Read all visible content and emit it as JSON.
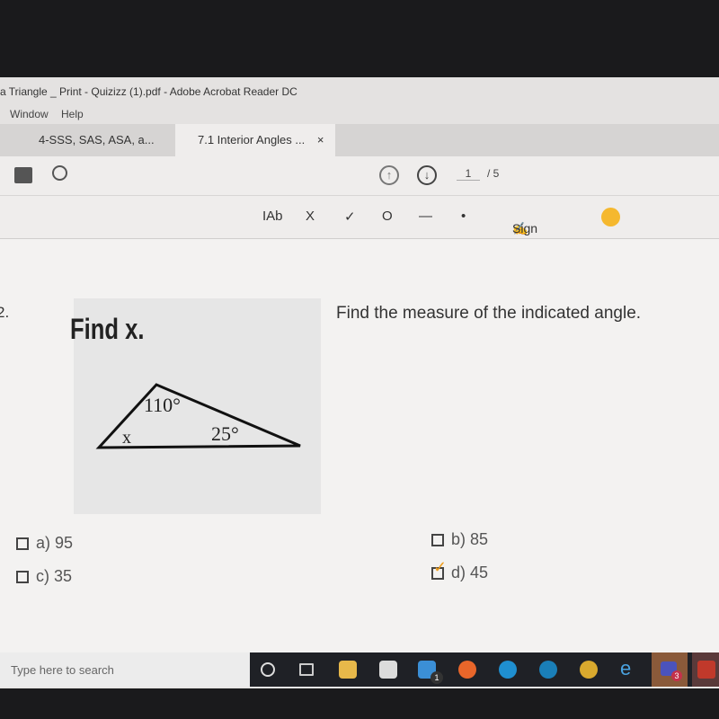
{
  "window": {
    "title": "a Triangle _ Print - Quizizz (1).pdf - Adobe Acrobat Reader DC"
  },
  "menu": [
    "Window",
    "Help"
  ],
  "tabs": [
    {
      "label": "4-SSS, SAS, ASA, a..."
    },
    {
      "label": "7.1 Interior Angles ...",
      "close": "×",
      "active": true
    }
  ],
  "toolbar": {
    "page_current": "1",
    "page_total": "/ 5"
  },
  "annotation_tools": {
    "text": "IAb",
    "cross": "X",
    "check": "✓",
    "circle": "O",
    "line": "—",
    "dot": "•",
    "sign": "Sign",
    "color": "#f5b82e"
  },
  "question": {
    "number": "2.",
    "figure_title": "Find x.",
    "angle_top": "110°",
    "angle_right": "25°",
    "angle_left": "x",
    "prompt": "Find the measure of the indicated angle."
  },
  "options": [
    {
      "label": "a) 95",
      "checked": false
    },
    {
      "label": "b) 85",
      "checked": false
    },
    {
      "label": "c) 35",
      "checked": false
    },
    {
      "label": "d) 45",
      "checked": true
    }
  ],
  "taskbar": {
    "search_placeholder": "Type here to search",
    "mail_badge": "1",
    "teams_badge": "3",
    "icons": [
      "cortana-icon",
      "task-view-icon",
      "file-explorer-icon",
      "store-icon",
      "mail-icon",
      "firefox-icon",
      "edge-icon",
      "edge-beta-icon",
      "chrome-icon",
      "internet-explorer-icon",
      "teams-icon",
      "acrobat-icon"
    ]
  }
}
